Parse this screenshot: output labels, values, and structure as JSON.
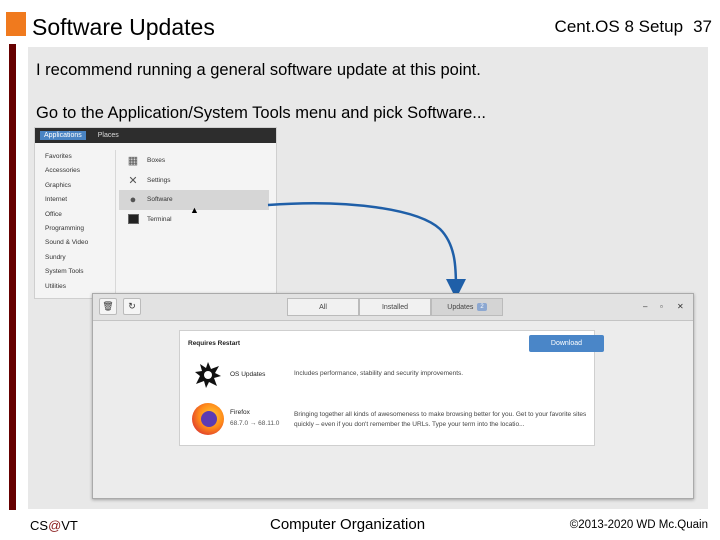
{
  "slide": {
    "title": "Software Updates",
    "course_label": "Cent.OS 8 Setup",
    "page_number": "37"
  },
  "content": {
    "line1": "I recommend running a general software update at this point.",
    "line2": "Go to the Application/System Tools menu and pick Software..."
  },
  "gnome_menu": {
    "topbar": [
      "Applications",
      "Places"
    ],
    "categories": [
      "Favorites",
      "Accessories",
      "Graphics",
      "Internet",
      "Office",
      "Programming",
      "Sound & Video",
      "Sundry",
      "System Tools",
      "Utilities"
    ],
    "apps": [
      {
        "label": "Boxes",
        "icon": "boxes-icon"
      },
      {
        "label": "Settings",
        "icon": "settings-icon"
      },
      {
        "label": "Software",
        "icon": "software-icon",
        "selected": true
      },
      {
        "label": "Terminal",
        "icon": "terminal-icon"
      }
    ]
  },
  "software_window": {
    "tabs": {
      "all": "All",
      "installed": "Installed",
      "updates": "Updates",
      "updates_count": "2"
    },
    "panel_title": "Requires Restart",
    "download_label": "Download",
    "rows": [
      {
        "name": "OS Updates",
        "description": "Includes performance, stability and security improvements.",
        "version": ""
      },
      {
        "name": "Firefox",
        "description": "Bringing together all kinds of awesomeness to make browsing better for you. Get to your favorite sites quickly – even if you don't remember the URLs. Type your term into the locatio...",
        "version": "68.7.0 → 68.11.0"
      }
    ]
  },
  "footer": {
    "left_prefix": "CS",
    "left_at": "@",
    "left_suffix": "VT",
    "center": "Computer Organization",
    "right": "©2013-2020 WD Mc.Quain"
  },
  "colors": {
    "accent": "#f07a1e",
    "bar": "#660000",
    "arrow": "#1f5fa8",
    "download": "#4a86c8"
  }
}
